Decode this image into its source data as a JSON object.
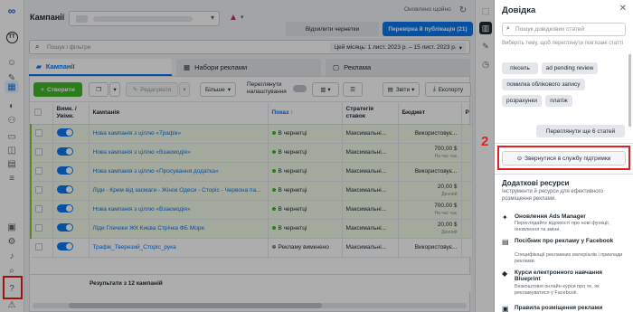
{
  "left_nav": {
    "items": [
      "meta-logo",
      "account-avatar",
      "smiley",
      "edit",
      "campaigns-table",
      "audience",
      "people",
      "billing",
      "catalog",
      "pages",
      "menu",
      "reports",
      "settings",
      "notifications",
      "search",
      "help",
      "bug-report"
    ],
    "annotation_1": "1"
  },
  "header": {
    "title": "Кампанії",
    "updated": "Оновлено щойно",
    "discard_drafts": "Відхилити чернетки",
    "review_publish": "Перевірка й публікація (21)"
  },
  "search": {
    "placeholder": "Пошук і фільтри",
    "date_range": "Цей місяць: 1 лист. 2023 р. – 15 лист. 2023 р."
  },
  "tabs": [
    {
      "label": "Кампанії",
      "icon": "folder-icon"
    },
    {
      "label": "Набори реклами",
      "icon": "grid-icon"
    },
    {
      "label": "Реклама",
      "icon": "ad-icon"
    }
  ],
  "toolbar": {
    "create": "Створити",
    "edit": "Редагувати",
    "more": "Більше",
    "review_settings": "Переглянути налаштування",
    "reports": "Звіти",
    "export": "Експорту"
  },
  "table": {
    "headers": [
      "",
      "Вимк. / Увімк.",
      "Кампанія",
      "Показ",
      "Стратегія ставок",
      "Бюджет",
      "Р"
    ],
    "rows": [
      {
        "name": "Нова кампанія з ціллю «Трафік»",
        "delivery": "В чернетці",
        "strategy": "Максимальні...",
        "budget": "Використовує...",
        "budget_sub": ""
      },
      {
        "name": "Нова кампанія з ціллю «Взаємодія»",
        "delivery": "В чернетці",
        "strategy": "Максимальні...",
        "budget": "700,00 $",
        "budget_sub": "На час чає"
      },
      {
        "name": "Нова кампанія з ціллю «Просування додатка»",
        "delivery": "В чернетці",
        "strategy": "Максимальні...",
        "budget": "Використовує...",
        "budget_sub": ""
      },
      {
        "name": "Ліди - Крем від засмаги - Жінок Одеси - Сторіс - Червона па...",
        "delivery": "В чернетці",
        "strategy": "Максимальні...",
        "budget": "20,00 $",
        "budget_sub": "Денний"
      },
      {
        "name": "Нова кампанія з ціллю «Взаємодія»",
        "delivery": "В чернетці",
        "strategy": "Максимальні...",
        "budget": "700,00 $",
        "budget_sub": "На час чає"
      },
      {
        "name": "Ліди Глечики ЖК Києва Стрічка ФБ Море",
        "delivery": "В чернетці",
        "strategy": "Максимальні...",
        "budget": "20,00 $",
        "budget_sub": "Денний"
      },
      {
        "name": "Трафік_Тверезий_Сторіс_рука",
        "delivery": "Рекламу вимкнено",
        "strategy": "Максимальні...",
        "budget": "Використовує...",
        "budget_sub": ""
      }
    ],
    "results": "Результати з 12 кампаній"
  },
  "help": {
    "title": "Довідка",
    "search_placeholder": "Пошук довідкових статей",
    "hint": "Виберіть тему, щоб переглянути пов'язані статті",
    "chips": [
      "піксель",
      "ad pending review",
      "помилка облікового запису",
      "розрахунки",
      "платіж"
    ],
    "more_articles": "Переглянути ще 6 статей",
    "contact": "Звернутися в службу підтримки",
    "annotation_2": "2",
    "resources_title": "Додаткові ресурси",
    "resources_sub": "Інструменти й ресурси для ефективного розміщення реклами.",
    "resources": [
      {
        "title": "Оновлення Ads Manager",
        "desc": "Переглядайте відомості про нові функції, оновлення та зміни."
      },
      {
        "title": "Посібник про рекламу у Facebook",
        "desc": "Специфікації рекламних матеріалів і приклади реклами."
      },
      {
        "title": "Курси електронного навчання Blueprint",
        "desc": "Безкоштовні онлайн-курси про те, як рекламуватися у Facebook."
      },
      {
        "title": "Правила розміщення реклами",
        "desc": ""
      }
    ]
  },
  "colors": {
    "accent": "#0a78f0",
    "create_green": "#42b72a",
    "annotation_red": "#e02020",
    "draft_row": "#f2f9e9"
  }
}
